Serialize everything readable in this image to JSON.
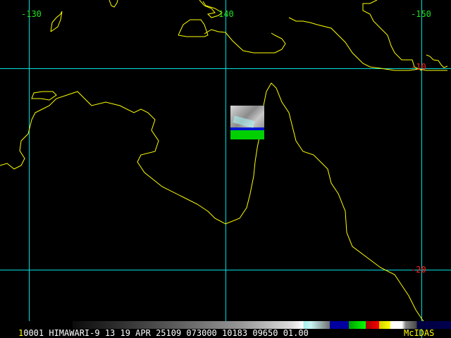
{
  "map": {
    "longitude_labels": [
      "-130",
      "140",
      "-150"
    ],
    "latitude_labels": [
      "-10",
      "-20"
    ],
    "colors": {
      "coastline": "#ffff00",
      "grid": "#00e0e0",
      "lon_label": "#20e020",
      "lat_label": "#ff2020"
    }
  },
  "status_bar": {
    "frame_prefix": "1",
    "text": "0001 HIMAWARI-9 13 19 APR 25109 073000 10183 09650 01.00",
    "brand": "McIDAS"
  }
}
